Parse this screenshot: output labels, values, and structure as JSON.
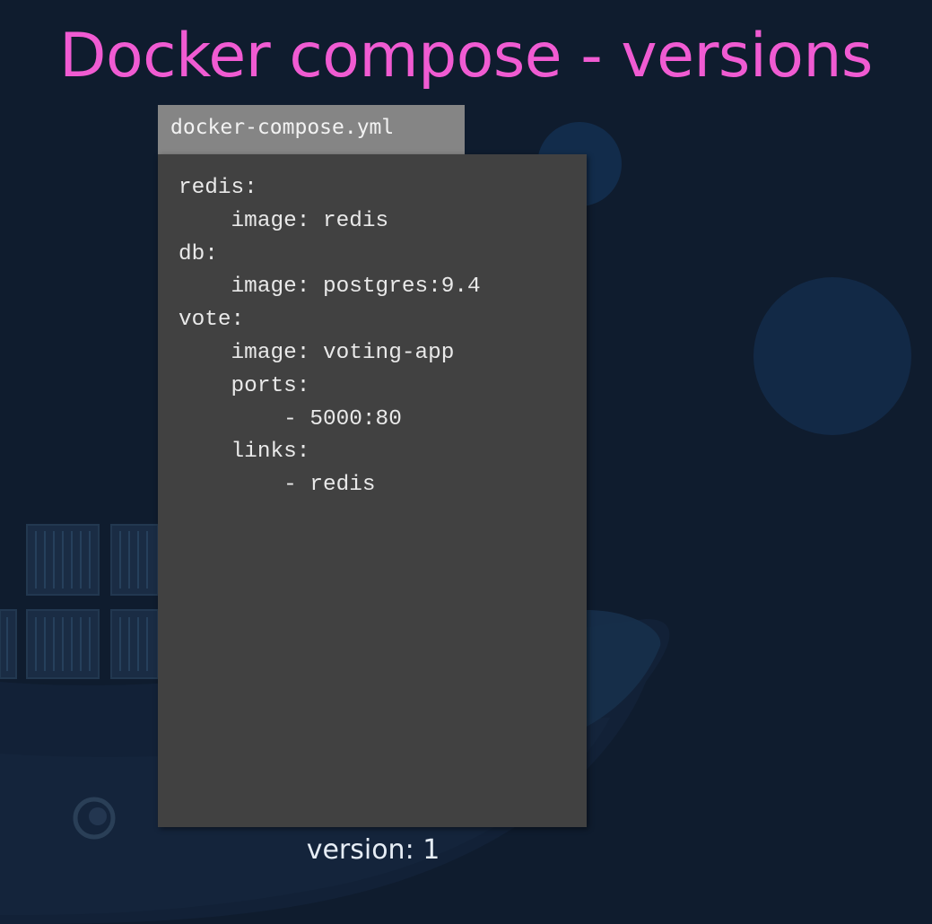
{
  "slide": {
    "title": "Docker compose - versions",
    "file_name": "docker-compose.yml",
    "code_lines": [
      "redis:",
      "    image: redis",
      "db:",
      "    image: postgres:9.4",
      "vote:",
      "    image: voting-app",
      "    ports:",
      "        - 5000:80",
      "    links:",
      "        - redis"
    ],
    "version_label": "version: 1"
  },
  "colors": {
    "background": "#0f1c2e",
    "title": "#f05bd2",
    "tab": "#858585",
    "panel": "#414141",
    "code_text": "#e9e9e9"
  },
  "icons": {
    "background_art": "docker-whale-illustration"
  }
}
